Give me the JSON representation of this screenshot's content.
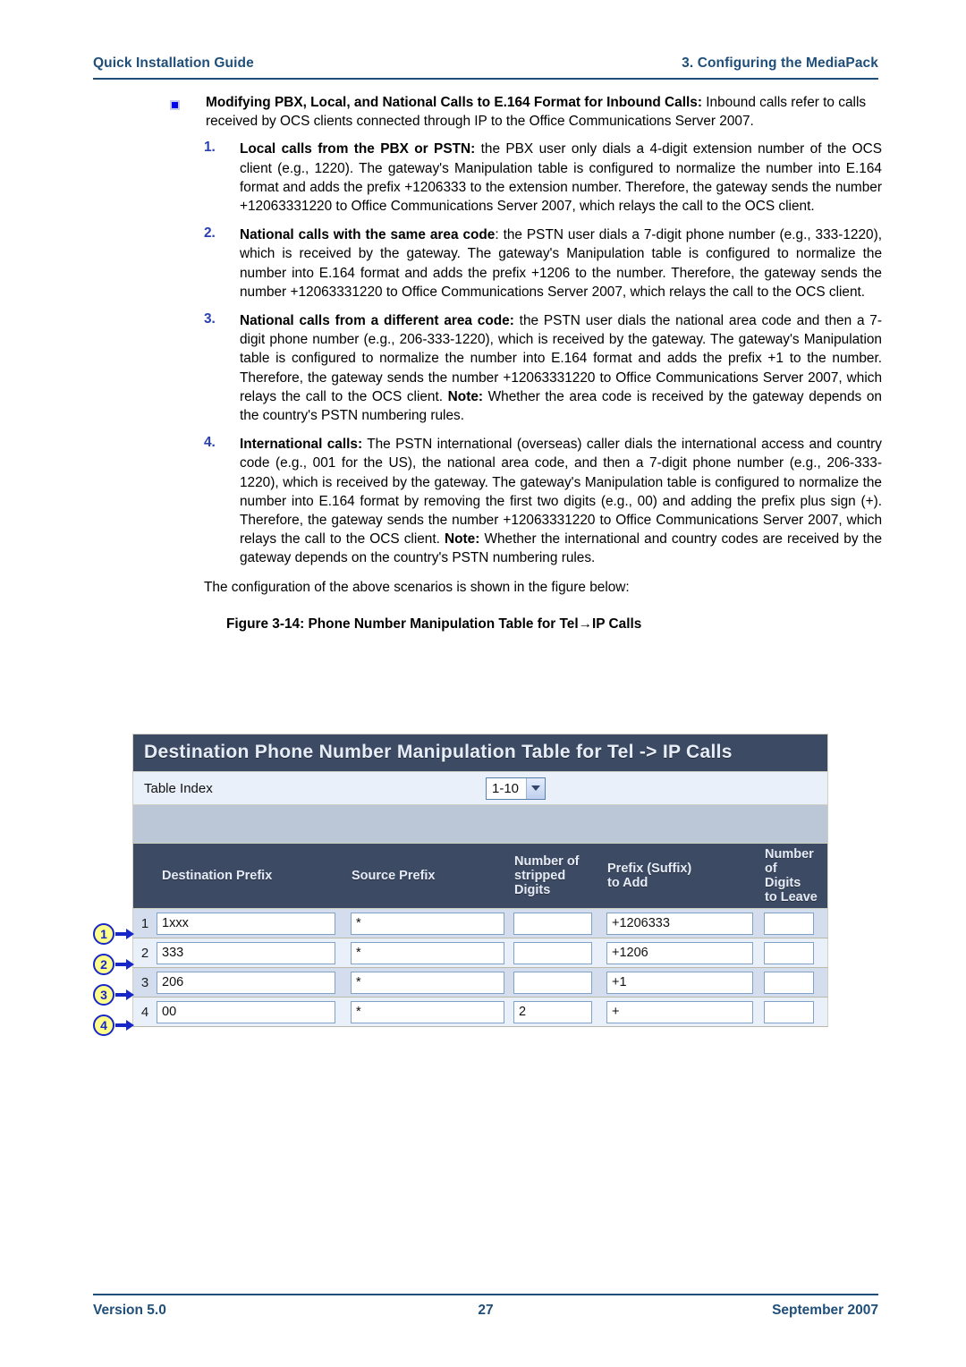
{
  "header": {
    "left": "Quick Installation Guide",
    "right": "3. Configuring the MediaPack"
  },
  "bullet": {
    "title": "Modifying PBX, Local, and National Calls to E.164 Format for Inbound Calls:",
    "body": " Inbound calls refer to calls received by OCS clients connected through IP to the Office Communications Server 2007."
  },
  "items": [
    {
      "num": "1.",
      "title": "Local calls from the PBX or PSTN:",
      "body": " the PBX user only dials a 4-digit extension number of the OCS client (e.g., 1220). The gateway's Manipulation table is configured to normalize the number into E.164 format and adds the prefix +1206333 to the extension number. Therefore, the gateway sends the number +12063331220 to Office Communications Server 2007, which relays the call to the OCS client."
    },
    {
      "num": "2.",
      "title": "National calls with the same area code",
      "body": ": the PSTN user dials a 7-digit phone number (e.g., 333-1220), which is received by the gateway. The gateway's Manipulation table is configured to normalize the number into E.164 format and adds the prefix +1206 to the number. Therefore, the gateway sends the number +12063331220 to Office Communications Server 2007, which relays the call to the OCS client."
    },
    {
      "num": "3.",
      "title": "National calls from a different area code:",
      "body": " the PSTN user dials the national area code and then a 7-digit phone number (e.g., 206-333-1220), which is received by the gateway. The gateway's Manipulation table is configured to normalize the number into E.164 format and adds the prefix +1 to the number. Therefore, the gateway sends the number +12063331220 to Office Communications Server 2007, which relays the call to the OCS client. ",
      "note_label": "Note:",
      "note_body": " Whether the area code is received by the gateway depends on the country's PSTN numbering rules."
    },
    {
      "num": "4.",
      "title": "International calls:",
      "body": " The PSTN international (overseas) caller dials the international access and country code (e.g., 001 for the US), the national area code, and then a 7-digit phone number (e.g., 206-333-1220), which is received by the gateway. The gateway's Manipulation table is configured to normalize the number into E.164 format by removing the first two digits (e.g., 00) and adding the prefix plus sign (+). Therefore, the gateway sends the number +12063331220 to Office Communications Server 2007, which relays the call to the OCS client. ",
      "note_label": "Note:",
      "note_body": " Whether the international and country codes are received by the gateway depends on the country's PSTN numbering rules."
    }
  ],
  "intro_figure": "The configuration of the above scenarios is shown in the figure below:",
  "figure_caption": "Figure 3-14: Phone Number Manipulation Table for Tel→IP Calls",
  "app": {
    "title": "Destination Phone Number Manipulation Table for Tel -> IP Calls",
    "table_index_label": "Table Index",
    "table_index_value": "1-10",
    "columns": [
      "Destination Prefix",
      "Source Prefix",
      "Number of\nstripped\nDigits",
      "Prefix (Suffix)\nto Add",
      "Number of\nDigits\n to Leave"
    ],
    "rows": [
      {
        "index": "1",
        "destination_prefix": "1xxx",
        "source_prefix": "*",
        "stripped_digits": "",
        "prefix_to_add": "+1206333",
        "digits_to_leave": "",
        "callout": "1"
      },
      {
        "index": "2",
        "destination_prefix": "333",
        "source_prefix": "*",
        "stripped_digits": "",
        "prefix_to_add": "+1206",
        "digits_to_leave": "",
        "callout": "2"
      },
      {
        "index": "3",
        "destination_prefix": "206",
        "source_prefix": "*",
        "stripped_digits": "",
        "prefix_to_add": "+1",
        "digits_to_leave": "",
        "callout": "3"
      },
      {
        "index": "4",
        "destination_prefix": "00",
        "source_prefix": "*",
        "stripped_digits": "2",
        "prefix_to_add": "+",
        "digits_to_leave": "",
        "callout": "4"
      }
    ]
  },
  "footer": {
    "left": "Version 5.0",
    "page": "27",
    "right": "September 2007"
  },
  "colors": {
    "accent_blue": "#1f4e79",
    "bullet_blue": "#0000ee",
    "number_blue": "#2a3fb0",
    "app_header_bg": "#3d4a63",
    "callout_fill": "#ffff8a",
    "callout_border": "#1726c8"
  }
}
